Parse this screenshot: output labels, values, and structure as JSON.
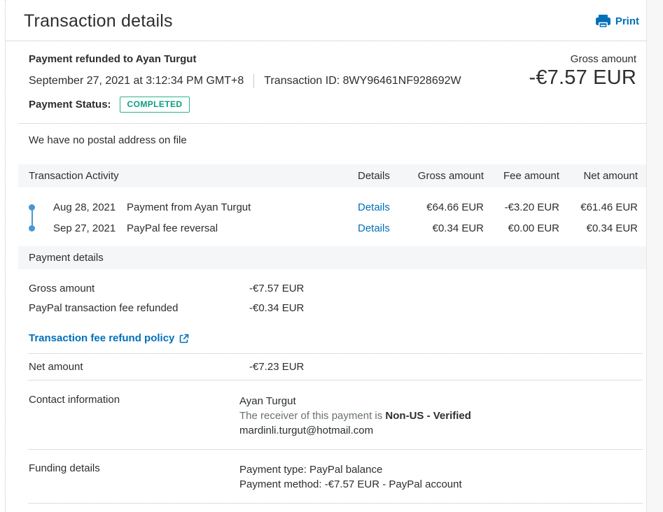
{
  "header": {
    "title": "Transaction details",
    "print_label": "Print"
  },
  "summary": {
    "payment_line": "Payment refunded to Ayan Turgut",
    "datetime": "September 27, 2021 at 3:12:34 PM GMT+8",
    "transaction_id_label": "Transaction ID:",
    "transaction_id": "8WY96461NF928692W",
    "payment_status_label": "Payment Status:",
    "payment_status": "COMPLETED",
    "gross_amount_label": "Gross amount",
    "gross_amount_value": "-€7.57 EUR"
  },
  "postal_note": "We have no postal address on file",
  "activity": {
    "title": "Transaction Activity",
    "columns": {
      "details": "Details",
      "gross": "Gross amount",
      "fee": "Fee amount",
      "net": "Net amount"
    },
    "rows": [
      {
        "date": "Aug 28, 2021",
        "description": "Payment from Ayan Turgut",
        "details_label": "Details",
        "gross": "€64.66 EUR",
        "fee": "-€3.20 EUR",
        "net": "€61.46 EUR"
      },
      {
        "date": "Sep 27, 2021",
        "description": "PayPal fee reversal",
        "details_label": "Details",
        "gross": "€0.34 EUR",
        "fee": "€0.00 EUR",
        "net": "€0.34 EUR"
      }
    ]
  },
  "payment_details": {
    "title": "Payment details",
    "gross_label": "Gross amount",
    "gross_value": "-€7.57 EUR",
    "fee_label": "PayPal transaction fee refunded",
    "fee_value": "-€0.34 EUR",
    "policy_link": "Transaction fee refund policy",
    "net_label": "Net amount",
    "net_value": "-€7.23 EUR"
  },
  "contact": {
    "label": "Contact information",
    "name": "Ayan Turgut",
    "receiver_prefix": "The receiver of this payment is ",
    "receiver_status": "Non-US - Verified",
    "email": "mardinli.turgut@hotmail.com"
  },
  "funding": {
    "label": "Funding details",
    "payment_type": "Payment type: PayPal balance",
    "payment_method": "Payment method: -€7.57 EUR - PayPal account"
  },
  "colors": {
    "link_blue": "#0070ba",
    "status_green": "#0b9e7d",
    "timeline_blue": "#4a97d4",
    "band_background": "#f4f6f8"
  }
}
